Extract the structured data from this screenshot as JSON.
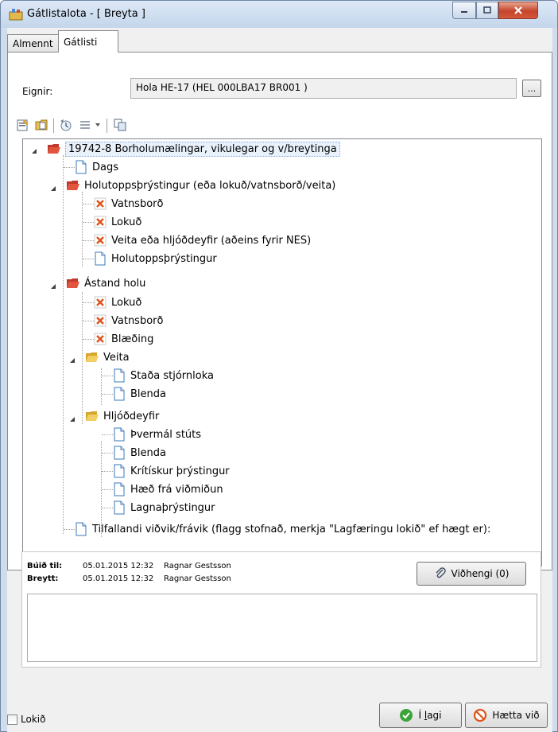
{
  "window": {
    "title": "Gátlistalota - [ Breyta ]"
  },
  "tabs": [
    {
      "label": "Almennt"
    },
    {
      "label": "Gátlisti"
    }
  ],
  "asset": {
    "label": "Eignir:",
    "value": "Hola HE-17 (HEL  000LBA17 BR001 )",
    "browse_label": "..."
  },
  "tree": {
    "root": "19742-8 Borholumælingar, vikulegar og v/breytinga",
    "items": [
      {
        "label": "Dags"
      },
      {
        "label": "Holutoppsþrýstingur (eða lokuð/vatnsborð/veita)"
      },
      {
        "label": "Vatnsborð"
      },
      {
        "label": "Lokuð"
      },
      {
        "label": "Veita eða hljóðdeyfir (aðeins fyrir NES)"
      },
      {
        "label": "Holutoppsþrýstingur"
      },
      {
        "label": "Ástand holu"
      },
      {
        "label": "Lokuð"
      },
      {
        "label": "Vatnsborð"
      },
      {
        "label": "Blæðing"
      },
      {
        "label": "Veita"
      },
      {
        "label": "Staða stjórnloka"
      },
      {
        "label": "Blenda"
      },
      {
        "label": "Hljóðdeyfir"
      },
      {
        "label": "Þvermál stúts"
      },
      {
        "label": "Blenda"
      },
      {
        "label": "Krítískur þrýstingur"
      },
      {
        "label": "Hæð frá viðmiðun"
      },
      {
        "label": "Lagnaþrýstingur"
      },
      {
        "label": "Tilfallandi viðvik/frávik (flagg stofnað, merkja \"Lagfæringu lokið\" ef hægt er):"
      }
    ]
  },
  "info": {
    "created_label": "Búið til:",
    "created_value": "05.01.2015 12:32",
    "created_by": "Ragnar Gestsson",
    "changed_label": "Breytt:",
    "changed_value": "05.01.2015 12:32",
    "changed_by": "Ragnar Gestsson",
    "attachments_label": "Viðhengi (0)"
  },
  "footer": {
    "done_label": "Lokið",
    "ok_prefix": "Í ",
    "ok_underlined": "l",
    "ok_suffix": "agi",
    "cancel_label": "Hætta við"
  }
}
